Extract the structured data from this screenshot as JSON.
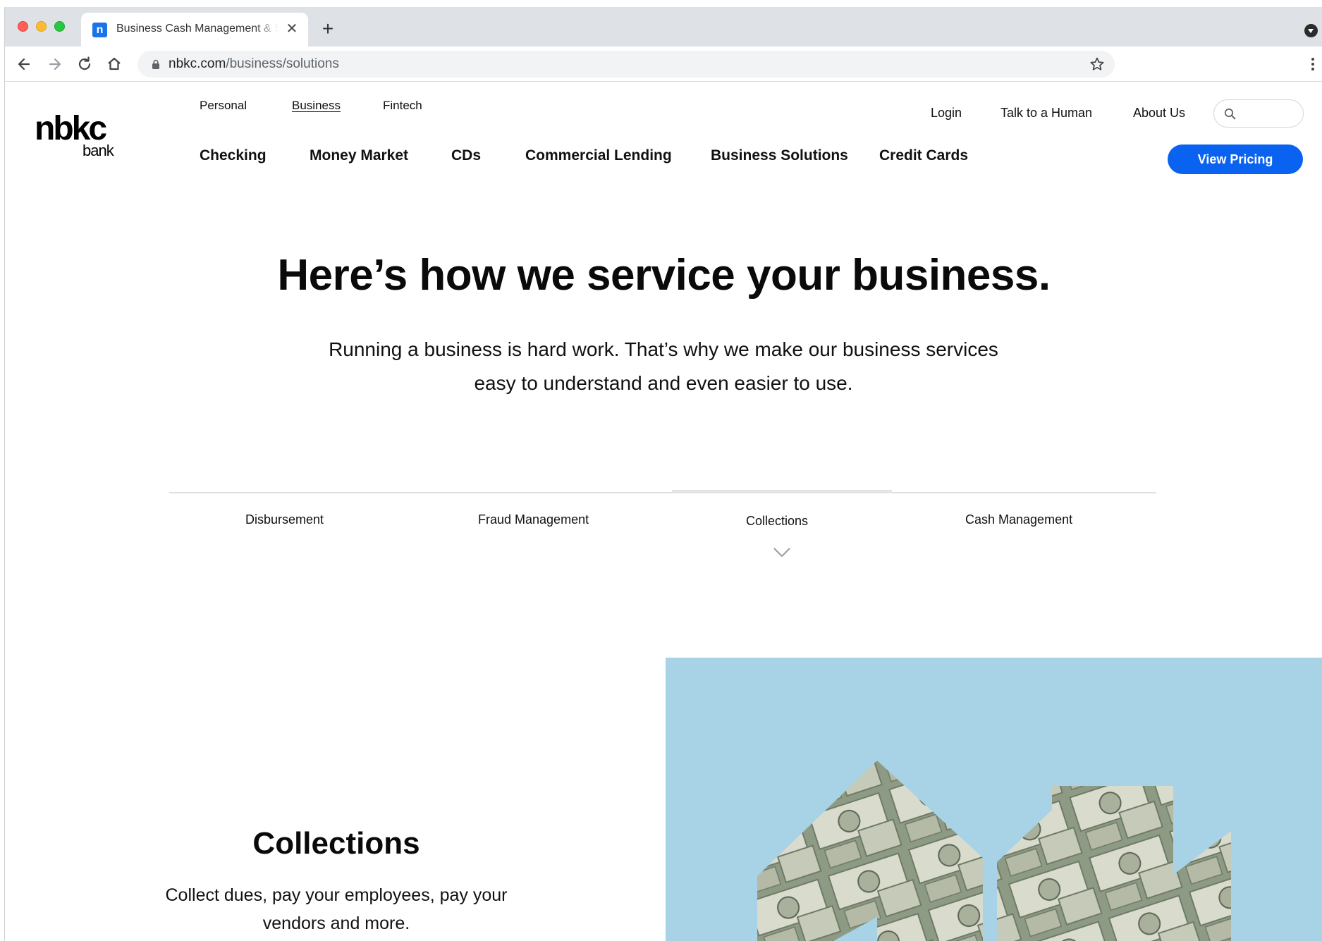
{
  "browser": {
    "tab_title": "Business Cash Management & Solutions | nbkc bank",
    "tab_favicon": "n",
    "url_domain": "nbkc.com",
    "url_path": "/business/solutions"
  },
  "logo": {
    "main": "nbkc",
    "sub": "bank"
  },
  "top_nav": [
    {
      "label": "Personal",
      "active": false
    },
    {
      "label": "Business",
      "active": true
    },
    {
      "label": "Fintech",
      "active": false
    }
  ],
  "utility_nav": {
    "login": "Login",
    "talk": "Talk to a Human",
    "about": "About Us"
  },
  "main_nav": [
    "Checking",
    "Money Market",
    "CDs",
    "Commercial Lending",
    "Business Solutions",
    "Credit Cards"
  ],
  "cta": {
    "label": "View Pricing",
    "color": "#0a63f0"
  },
  "hero": {
    "title": "Here’s how we service your business.",
    "line1": "Running a business is hard work. That’s why we make our business services",
    "line2": "easy to understand and even easier to use."
  },
  "solution_tabs": [
    "Disbursement",
    "Fraud Management",
    "Collections",
    "Cash Management"
  ],
  "active_solution_tab": "Collections",
  "section": {
    "title": "Collections",
    "line1": "Collect dues, pay your employees, pay your",
    "line2": "vendors and more."
  },
  "image_bg_color": "#a8d3e6"
}
